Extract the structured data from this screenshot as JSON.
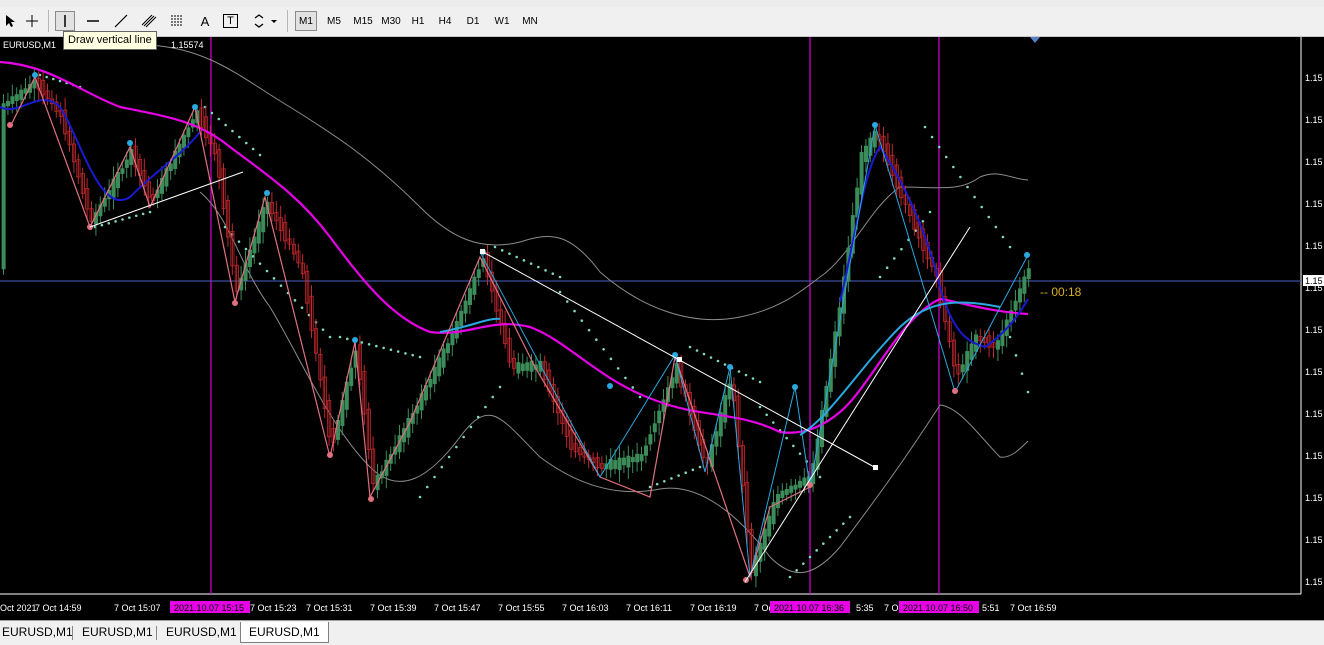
{
  "toolbar": {
    "timeframes": [
      "M1",
      "M5",
      "M15",
      "M30",
      "H1",
      "H4",
      "D1",
      "W1",
      "MN"
    ],
    "active_timeframe": "M1",
    "text_tool_glyph": "A",
    "label_tool_glyph": "T",
    "tooltip": "Draw vertical line"
  },
  "chart": {
    "symbol": "EURUSD,M1",
    "header_price": "1.15574",
    "price_axis_label": "1.15",
    "current_price_label": "1.15",
    "countdown": "-- 00:18",
    "time_labels": [
      "Oct 2021",
      "7 Oct 14:59",
      "7 Oct 15:07",
      "7 Oct 15:23",
      "7 Oct 15:31",
      "7 Oct 15:39",
      "7 Oct 15:47",
      "7 Oct 15:55",
      "7 Oct 16:03",
      "7 Oct 16:11",
      "7 Oct 16:19",
      "7 Oct 16",
      "5:35",
      "7 O",
      "5:51",
      "7 Oct 16:59"
    ],
    "vline_labels": [
      "2021.10.07 15:15",
      "2021.10.07 16:36",
      "2021.10.07 16:50"
    ],
    "colors": {
      "background": "#000000",
      "grid_label": "#ffffff",
      "bull_candle": "#3c8c5a",
      "bear_candle": "#c0282d",
      "slow_ma": "#e600e6",
      "fast_ma": "#1414dc",
      "sar_dots": "#80d8c0",
      "envelope": "#8c8c8c",
      "zigzag": "#2aa8e0",
      "vline": "#ff00ff",
      "countdown": "#d8b020"
    }
  },
  "tabs": [
    "EURUSD,M1",
    "EURUSD,M1",
    "EURUSD,M1",
    "EURUSD,M1"
  ],
  "active_tab": 3
}
